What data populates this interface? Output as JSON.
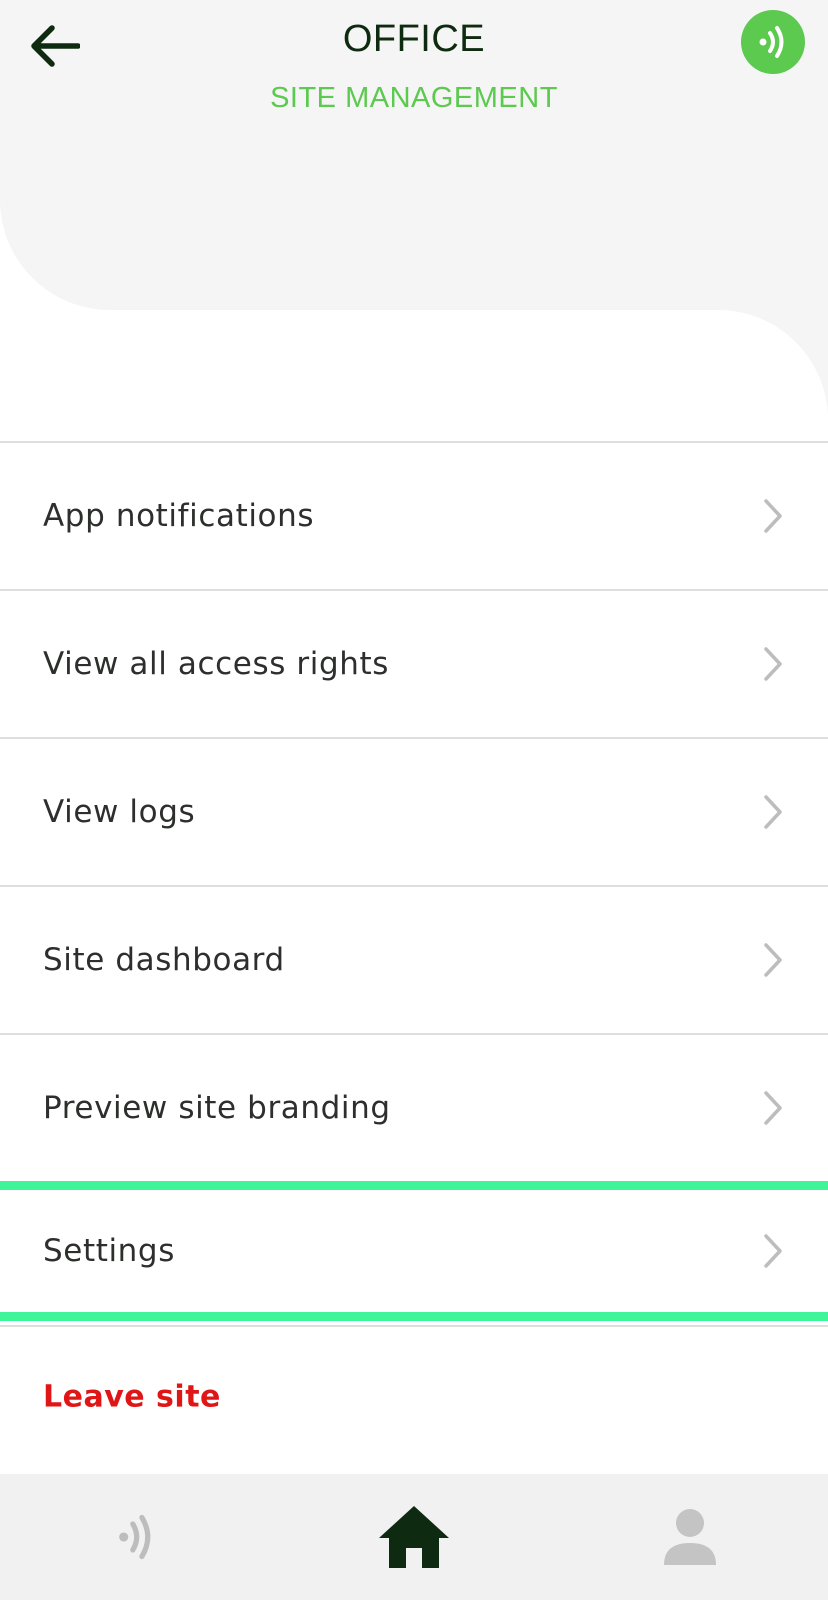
{
  "header": {
    "title": "OFFICE",
    "subtitle": "SITE MANAGEMENT",
    "back_icon": "arrow-left-icon",
    "badge_icon": "nfc-signal-icon"
  },
  "menu": {
    "items": [
      {
        "label": "App notifications"
      },
      {
        "label": "View all access rights"
      },
      {
        "label": "View logs"
      },
      {
        "label": "Site dashboard"
      },
      {
        "label": "Preview site branding"
      },
      {
        "label": "Settings"
      }
    ],
    "leave_label": "Leave site"
  },
  "bottom_nav": {
    "items": [
      {
        "icon": "nfc-signal-icon"
      },
      {
        "icon": "home-icon"
      },
      {
        "icon": "profile-icon"
      }
    ]
  },
  "colors": {
    "accent_green": "#5cc94f",
    "highlight": "#3ef59a",
    "danger": "#e01515",
    "title_dark": "#0e2a10"
  }
}
